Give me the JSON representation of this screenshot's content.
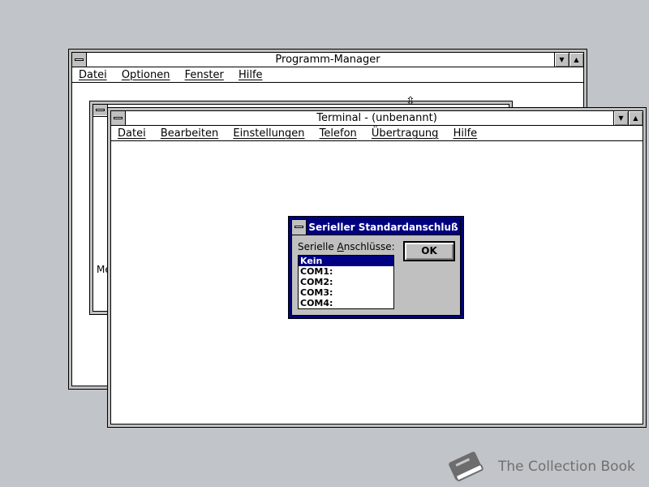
{
  "program_manager": {
    "title": "Programm-Manager",
    "menu": [
      "Datei",
      "Optionen",
      "Fenster",
      "Hilfe"
    ],
    "inner_window_partial_text": "Me"
  },
  "terminal": {
    "title": "Terminal - (unbenannt)",
    "menu": [
      "Datei",
      "Bearbeiten",
      "Einstellungen",
      "Telefon",
      "Übertragung",
      "Hilfe"
    ]
  },
  "dialog": {
    "title": "Serieller Standardanschluß",
    "label_prefix": "Serielle ",
    "label_accel": "A",
    "label_suffix": "nschlüsse:",
    "ports": [
      "Kein",
      "COM1:",
      "COM2:",
      "COM3:",
      "COM4:"
    ],
    "selected_index": 0,
    "ok_label": "OK"
  },
  "icons": {
    "system_menu": "system-menu-icon",
    "minimize": "minimize-icon",
    "maximize": "maximize-icon",
    "resize_cursor": "resize-cursor-icon",
    "book": "book-icon"
  },
  "colors": {
    "desktop": "#c1c4c8",
    "dialog_title": "#000080",
    "selection": "#000080"
  },
  "watermark": {
    "text": "The Collection Book"
  }
}
